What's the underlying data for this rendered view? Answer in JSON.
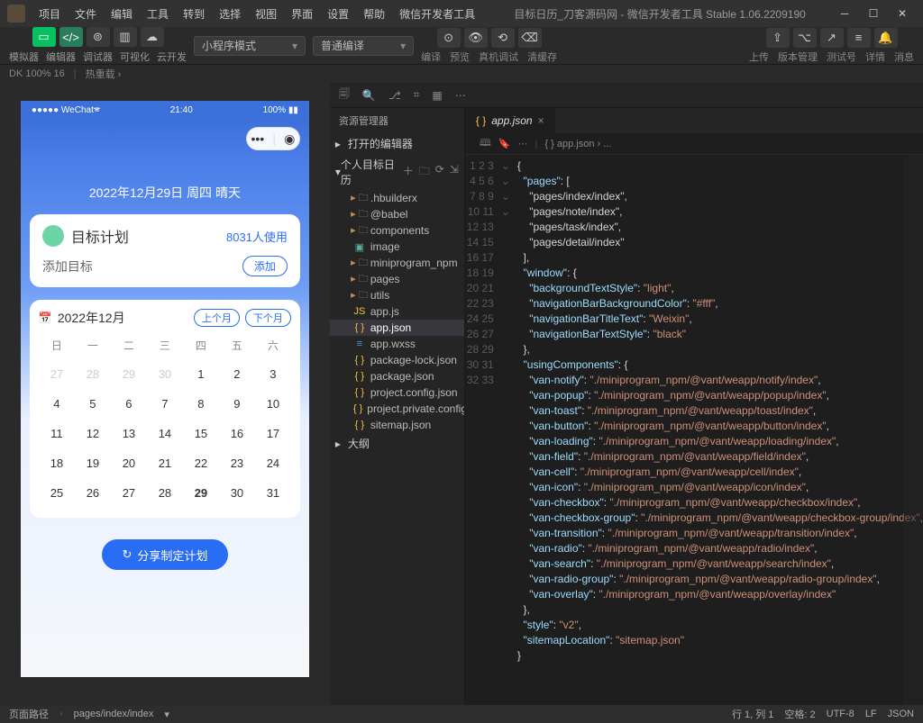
{
  "titlebar": {
    "menus": [
      "项目",
      "文件",
      "编辑",
      "工具",
      "转到",
      "选择",
      "视图",
      "界面",
      "设置",
      "帮助",
      "微信开发者工具"
    ],
    "title": "目标日历_刀客源码网 - 微信开发者工具 Stable 1.06.2209190"
  },
  "toolbar": {
    "labels_left": [
      "模拟器",
      "编辑器",
      "调试器",
      "可视化",
      "云开发"
    ],
    "select1": "小程序模式",
    "select2": "普通编译",
    "mid_labels": [
      "编译",
      "预览",
      "真机调试",
      "清缓存"
    ],
    "right_labels": [
      "上传",
      "版本管理",
      "测试号",
      "详情",
      "消息"
    ]
  },
  "subbar": {
    "zoom": "DK 100% 16",
    "hot": "热重载 ›"
  },
  "simulator": {
    "status_left": "●●●●● WeChat⁠🕿",
    "status_time": "21:40",
    "status_right": "100% ▮▮",
    "date_line": "2022年12月29日 周四 晴天",
    "card": {
      "title": "目标计划",
      "users": "8031人使用",
      "prompt": "添加目标",
      "add": "添加"
    },
    "calendar": {
      "title": "2022年12月",
      "prev": "上个月",
      "next": "下个月",
      "weekdays": [
        "日",
        "一",
        "二",
        "三",
        "四",
        "五",
        "六"
      ],
      "days": [
        {
          "n": "27",
          "dim": true
        },
        {
          "n": "28",
          "dim": true
        },
        {
          "n": "29",
          "dim": true
        },
        {
          "n": "30",
          "dim": true
        },
        {
          "n": "1"
        },
        {
          "n": "2"
        },
        {
          "n": "3"
        },
        {
          "n": "4"
        },
        {
          "n": "5"
        },
        {
          "n": "6"
        },
        {
          "n": "7"
        },
        {
          "n": "8"
        },
        {
          "n": "9"
        },
        {
          "n": "10"
        },
        {
          "n": "11"
        },
        {
          "n": "12"
        },
        {
          "n": "13"
        },
        {
          "n": "14"
        },
        {
          "n": "15"
        },
        {
          "n": "16"
        },
        {
          "n": "17"
        },
        {
          "n": "18"
        },
        {
          "n": "19"
        },
        {
          "n": "20"
        },
        {
          "n": "21"
        },
        {
          "n": "22"
        },
        {
          "n": "23"
        },
        {
          "n": "24"
        },
        {
          "n": "25"
        },
        {
          "n": "26"
        },
        {
          "n": "27"
        },
        {
          "n": "28"
        },
        {
          "n": "29",
          "today": true
        },
        {
          "n": "30"
        },
        {
          "n": "31"
        }
      ]
    },
    "share": "分享制定计划"
  },
  "explorer": {
    "title": "资源管理器",
    "section_open": "打开的编辑器",
    "project_name": "个人目标日历",
    "tree": [
      {
        "icon": "folder",
        "label": ".hbuilderx"
      },
      {
        "icon": "folder",
        "label": "@babel"
      },
      {
        "icon": "folder",
        "label": "components"
      },
      {
        "icon": "img",
        "label": "image"
      },
      {
        "icon": "folder",
        "label": "miniprogram_npm"
      },
      {
        "icon": "folder",
        "label": "pages"
      },
      {
        "icon": "folder",
        "label": "utils"
      },
      {
        "icon": "js",
        "label": "app.js"
      },
      {
        "icon": "json",
        "label": "app.json",
        "selected": true
      },
      {
        "icon": "css",
        "label": "app.wxss"
      },
      {
        "icon": "json",
        "label": "package-lock.json"
      },
      {
        "icon": "json",
        "label": "package.json"
      },
      {
        "icon": "json",
        "label": "project.config.json"
      },
      {
        "icon": "json",
        "label": "project.private.config.js..."
      },
      {
        "icon": "json",
        "label": "sitemap.json"
      }
    ],
    "outline": "大纲"
  },
  "editor": {
    "tab_name": "app.json",
    "breadcrumb": "{ } app.json › ...",
    "lines": [
      "{",
      "  \"pages\": [",
      "    \"pages/index/index\",",
      "    \"pages/note/index\",",
      "    \"pages/task/index\",",
      "    \"pages/detail/index\"",
      "  ],",
      "  \"window\": {",
      "    \"backgroundTextStyle\": \"light\",",
      "    \"navigationBarBackgroundColor\": \"#fff\",",
      "    \"navigationBarTitleText\": \"Weixin\",",
      "    \"navigationBarTextStyle\": \"black\"",
      "  },",
      "  \"usingComponents\": {",
      "    \"van-notify\": \"./miniprogram_npm/@vant/weapp/notify/index\",",
      "    \"van-popup\": \"./miniprogram_npm/@vant/weapp/popup/index\",",
      "    \"van-toast\": \"./miniprogram_npm/@vant/weapp/toast/index\",",
      "    \"van-button\": \"./miniprogram_npm/@vant/weapp/button/index\",",
      "    \"van-loading\": \"./miniprogram_npm/@vant/weapp/loading/index\",",
      "    \"van-field\": \"./miniprogram_npm/@vant/weapp/field/index\",",
      "    \"van-cell\": \"./miniprogram_npm/@vant/weapp/cell/index\",",
      "    \"van-icon\": \"./miniprogram_npm/@vant/weapp/icon/index\",",
      "    \"van-checkbox\": \"./miniprogram_npm/@vant/weapp/checkbox/index\",",
      "    \"van-checkbox-group\": \"./miniprogram_npm/@vant/weapp/checkbox-group/index\",",
      "    \"van-transition\": \"./miniprogram_npm/@vant/weapp/transition/index\",",
      "    \"van-radio\": \"./miniprogram_npm/@vant/weapp/radio/index\",",
      "    \"van-search\": \"./miniprogram_npm/@vant/weapp/search/index\",",
      "    \"van-radio-group\": \"./miniprogram_npm/@vant/weapp/radio-group/index\",",
      "    \"van-overlay\": \"./miniprogram_npm/@vant/weapp/overlay/index\"",
      "  },",
      "  \"style\": \"v2\",",
      "  \"sitemapLocation\": \"sitemap.json\"",
      "}"
    ]
  },
  "statusbar": {
    "page_path_label": "页面路径",
    "page_path": "pages/index/index",
    "pos": "行 1, 列 1",
    "spaces": "空格: 2",
    "encoding": "UTF-8",
    "eol": "LF",
    "lang": "JSON"
  }
}
